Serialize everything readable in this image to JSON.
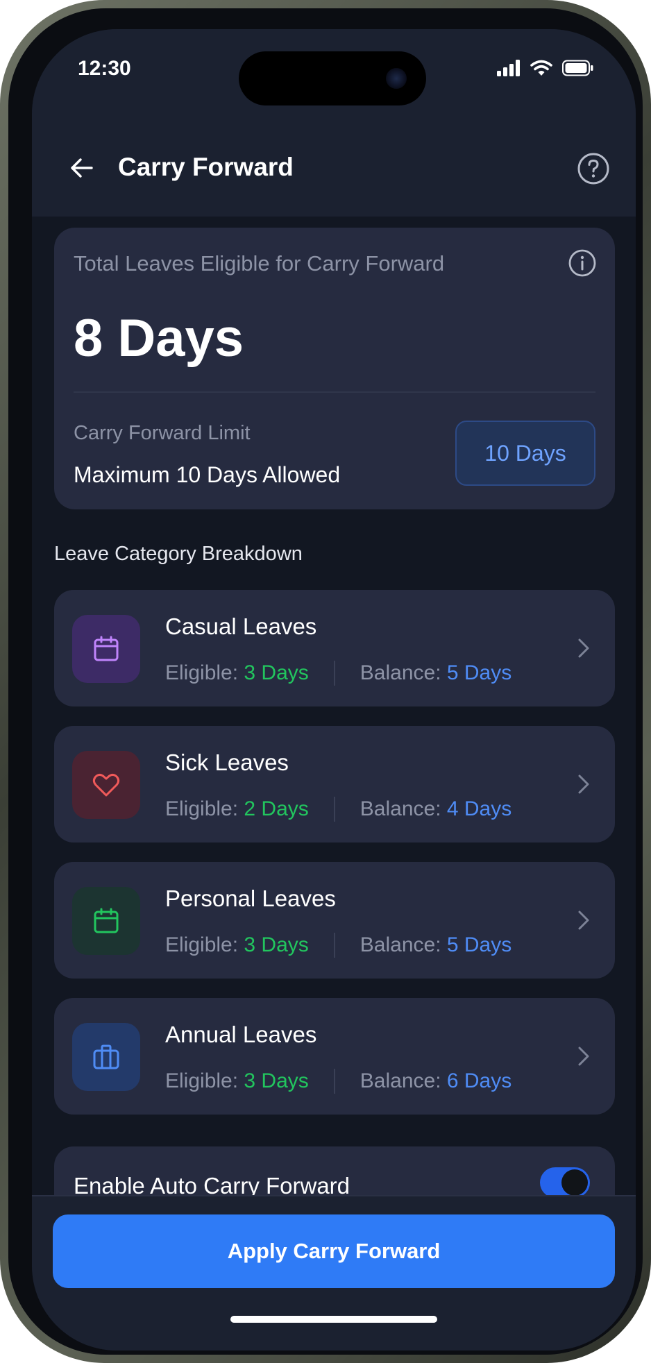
{
  "status_bar": {
    "time": "12:30"
  },
  "header": {
    "title": "Carry Forward",
    "back_icon": "arrow-left-icon",
    "help_icon": "help-circle-icon"
  },
  "summary": {
    "label": "Total Leaves Eligible for Carry Forward",
    "value": "8 Days",
    "limit_label": "Carry Forward Limit",
    "limit_description": "Maximum 10 Days Allowed",
    "limit_badge": "10 Days"
  },
  "breakdown": {
    "title": "Leave Category Breakdown",
    "eligible_label": "Eligible:",
    "balance_label": "Balance:",
    "items": [
      {
        "name": "Casual Leaves",
        "eligible": "3 Days",
        "balance": "5 Days",
        "icon": "calendar-icon",
        "icon_color": "#c084fc",
        "icon_bg": "#3d2b66"
      },
      {
        "name": "Sick Leaves",
        "eligible": "2 Days",
        "balance": "4 Days",
        "icon": "heart-icon",
        "icon_color": "#f05a5a",
        "icon_bg": "#4a2332"
      },
      {
        "name": "Personal Leaves",
        "eligible": "3 Days",
        "balance": "5 Days",
        "icon": "calendar-icon",
        "icon_color": "#22c55e",
        "icon_bg": "#1c3431"
      },
      {
        "name": "Annual Leaves",
        "eligible": "3 Days",
        "balance": "6 Days",
        "icon": "briefcase-icon",
        "icon_color": "#4f8cf5",
        "icon_bg": "#233a6a"
      }
    ]
  },
  "auto_carry": {
    "label": "Enable Auto Carry Forward",
    "enabled": true
  },
  "actions": {
    "apply_label": "Apply Carry Forward"
  },
  "colors": {
    "background": "#121722",
    "card": "#262b40",
    "accent": "#2f7bf6",
    "eligible": "#22c55e",
    "balance": "#4f8cf5"
  }
}
